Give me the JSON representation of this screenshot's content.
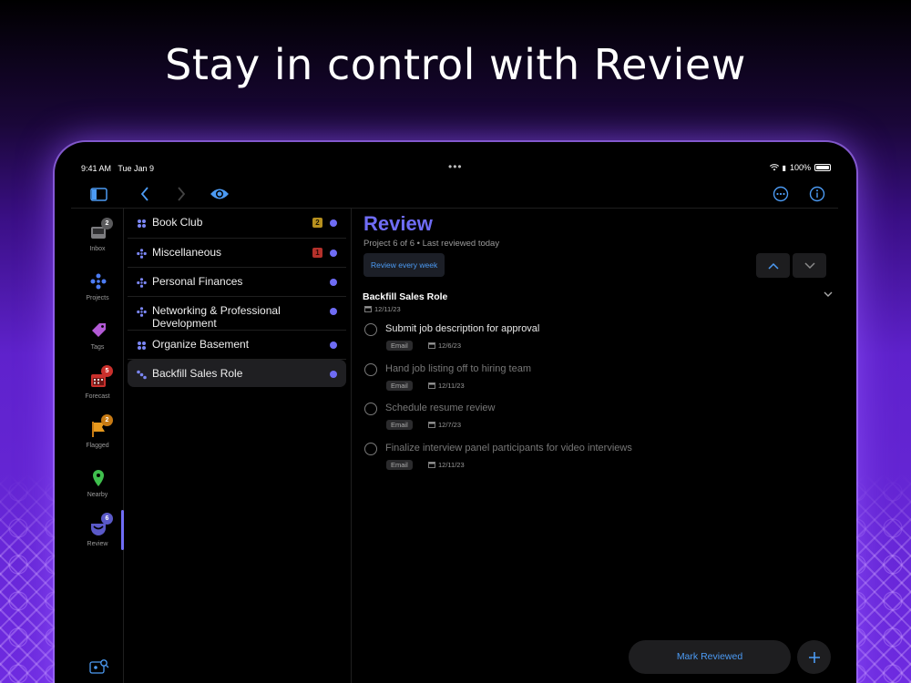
{
  "headline": "Stay in control with Review",
  "status": {
    "time": "9:41 AM",
    "date": "Tue Jan 9",
    "battery": "100%"
  },
  "rail": {
    "items": [
      {
        "label": "Inbox",
        "badge": "2",
        "badge_color": "#5a5a5c",
        "icon": "inbox-icon"
      },
      {
        "label": "Projects",
        "badge": "",
        "icon": "projects-icon"
      },
      {
        "label": "Tags",
        "badge": "",
        "icon": "tag-icon"
      },
      {
        "label": "Forecast",
        "badge": "5",
        "badge_color": "#c9302c",
        "icon": "calendar-icon"
      },
      {
        "label": "Flagged",
        "badge": "2",
        "badge_color": "#c77a14",
        "icon": "flag-icon"
      },
      {
        "label": "Nearby",
        "badge": "",
        "icon": "pin-icon"
      },
      {
        "label": "Review",
        "badge": "6",
        "badge_color": "#5a59c8",
        "icon": "review-icon"
      }
    ]
  },
  "projects": [
    {
      "name": "Book Club",
      "badge": "2",
      "badge_color": "#b7901e",
      "selected": false
    },
    {
      "name": "Miscellaneous",
      "badge": "1",
      "badge_color": "#b4312b",
      "selected": false
    },
    {
      "name": "Personal Finances",
      "badge": "",
      "selected": false
    },
    {
      "name": "Networking & Professional Development",
      "badge": "",
      "selected": false
    },
    {
      "name": "Organize Basement",
      "badge": "",
      "selected": false
    },
    {
      "name": "Backfill Sales Role",
      "badge": "",
      "selected": true
    }
  ],
  "detail": {
    "title": "Review",
    "subtitle": "Project 6 of 6 • Last reviewed today",
    "review_chip": "Review every week",
    "project_name": "Backfill Sales Role",
    "project_date": "12/11/23",
    "tasks": [
      {
        "title": "Submit job description for approval",
        "tag": "Email",
        "due": "12/6/23",
        "active": true
      },
      {
        "title": "Hand job listing off to hiring team",
        "tag": "Email",
        "due": "12/11/23",
        "active": false
      },
      {
        "title": "Schedule resume review",
        "tag": "Email",
        "due": "12/7/23",
        "active": false
      },
      {
        "title": "Finalize interview panel participants for video interviews",
        "tag": "Email",
        "due": "12/11/23",
        "active": false
      }
    ],
    "mark_reviewed": "Mark Reviewed"
  },
  "colors": {
    "accent": "#6f6cf5",
    "link": "#4c9bf4"
  }
}
